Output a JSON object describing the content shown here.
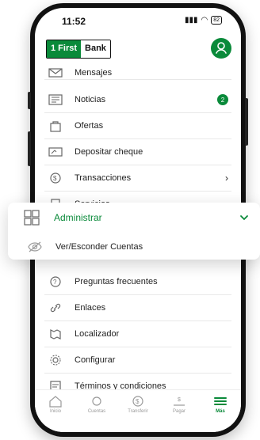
{
  "status": {
    "time": "11:52",
    "battery": "82"
  },
  "header": {
    "brand_prefix": "1 First",
    "brand_name": "Bank"
  },
  "menu": {
    "items": [
      {
        "label": "Mensajes",
        "icon": "envelope-icon"
      },
      {
        "label": "Noticias",
        "icon": "newspaper-icon",
        "badge": "2"
      },
      {
        "label": "Ofertas",
        "icon": "offers-icon"
      },
      {
        "label": "Depositar cheque",
        "icon": "cheque-icon"
      },
      {
        "label": "Transacciones",
        "icon": "transactions-icon",
        "chevron": true
      },
      {
        "label": "Servicios",
        "icon": "services-icon",
        "chevron": true
      },
      {
        "label": "Preguntas frecuentes",
        "icon": "help-icon"
      },
      {
        "label": "Enlaces",
        "icon": "link-icon"
      },
      {
        "label": "Localizador",
        "icon": "map-icon"
      },
      {
        "label": "Configurar",
        "icon": "gear-icon"
      },
      {
        "label": "Términos y condiciones",
        "icon": "document-icon"
      }
    ]
  },
  "popout": {
    "section_label": "Administrar",
    "sub_item_label": "Ver/Esconder Cuentas"
  },
  "tabbar": {
    "tabs": [
      {
        "label": "Inicio",
        "icon": "home-icon"
      },
      {
        "label": "Cuentas",
        "icon": "accounts-icon"
      },
      {
        "label": "Transferir",
        "icon": "transfer-icon"
      },
      {
        "label": "Pagar",
        "icon": "pay-icon"
      },
      {
        "label": "Más",
        "icon": "more-icon",
        "active": true
      }
    ]
  },
  "colors": {
    "accent": "#0a8a3a"
  }
}
